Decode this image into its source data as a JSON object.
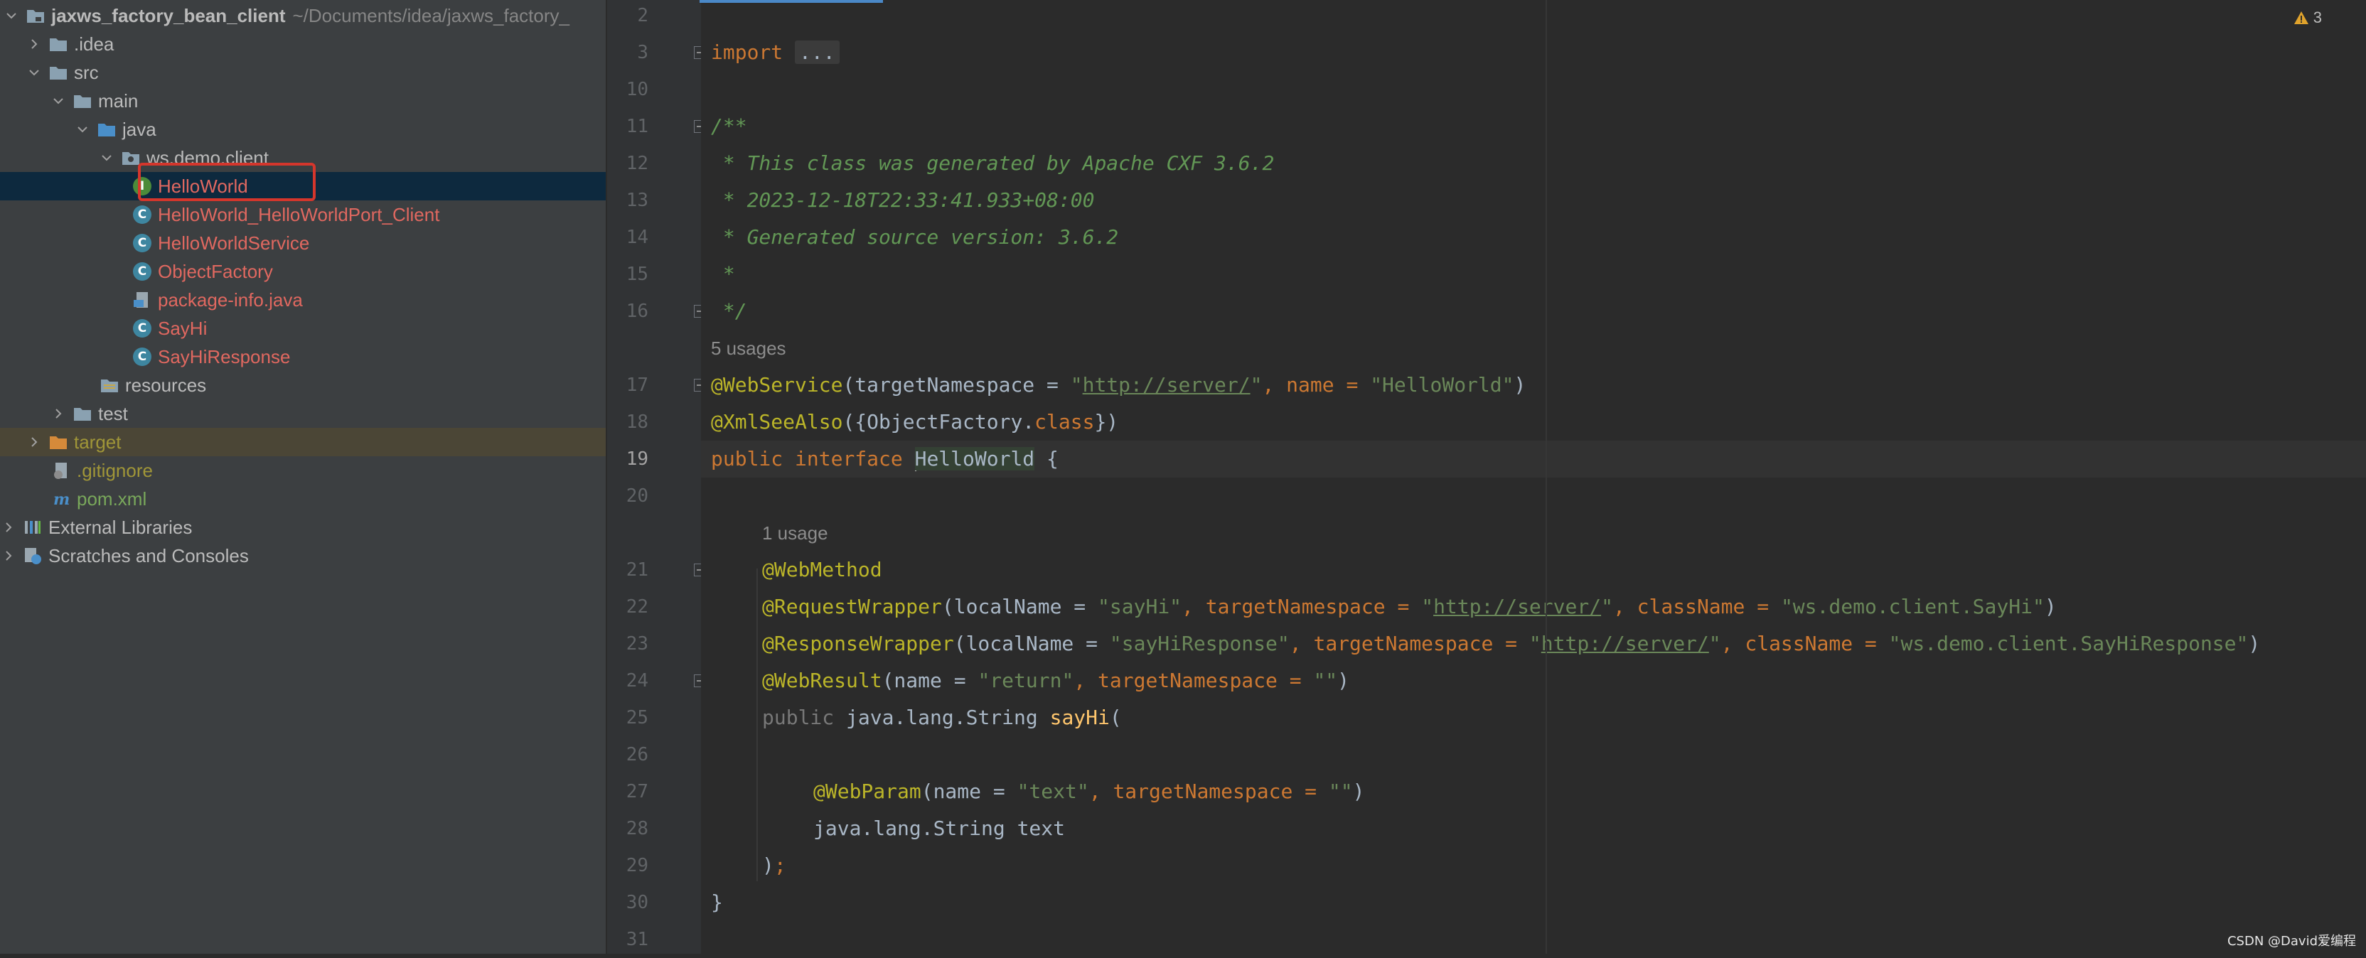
{
  "project_tree": {
    "root": {
      "name": "jaxws_factory_bean_client",
      "path": "~/Documents/idea/jaxws_factory_"
    },
    "items": [
      {
        "label": "jaxws_factory_bean_client"
      },
      {
        "label": ".idea"
      },
      {
        "label": "src"
      },
      {
        "label": "main"
      },
      {
        "label": "java"
      },
      {
        "label": "ws.demo.client"
      },
      {
        "label": "HelloWorld",
        "icon": "I"
      },
      {
        "label": "HelloWorld_HelloWorldPort_Client",
        "icon": "C"
      },
      {
        "label": "HelloWorldService",
        "icon": "C"
      },
      {
        "label": "ObjectFactory",
        "icon": "C"
      },
      {
        "label": "package-info.java"
      },
      {
        "label": "SayHi",
        "icon": "C"
      },
      {
        "label": "SayHiResponse",
        "icon": "C"
      },
      {
        "label": "resources"
      },
      {
        "label": "test"
      },
      {
        "label": "target"
      },
      {
        "label": ".gitignore"
      },
      {
        "label": "pom.xml"
      },
      {
        "label": "External Libraries"
      },
      {
        "label": "Scratches and Consoles"
      }
    ]
  },
  "editor": {
    "warnings_count": "3",
    "line_numbers": [
      "2",
      "3",
      "10",
      "11",
      "12",
      "13",
      "14",
      "15",
      "16",
      "17",
      "18",
      "19",
      "20",
      "21",
      "22",
      "23",
      "24",
      "25",
      "26",
      "27",
      "28",
      "29",
      "30",
      "31"
    ],
    "code": {
      "l3_import": "import",
      "l3_fold": "...",
      "l11": "/**",
      "l12": " * This class was generated by Apache CXF 3.6.2",
      "l13": " * 2023-12-18T22:33:41.933+08:00",
      "l14": " * Generated source version: 3.6.2",
      "l15": " *",
      "l16": " */",
      "usages_5": "5 usages",
      "l17": {
        "ann": "@WebService",
        "p1": "(targetNamespace = ",
        "q1": "\"",
        "url": "http://server/",
        "q2": "\"",
        "p2": ", name = ",
        "s1": "\"HelloWorld\"",
        "p3": ")"
      },
      "l18": {
        "ann": "@XmlSeeAlso",
        "p1": "({ObjectFactory.",
        "kw": "class",
        "p2": "})"
      },
      "l19": {
        "kw1": "public",
        "kw2": "interface",
        "name": "HelloWorld",
        "p1": " {"
      },
      "usages_1": "1 usage",
      "l21": "@WebMethod",
      "l22": {
        "ann": "@RequestWrapper",
        "p1": "(localName = ",
        "s1": "\"sayHi\"",
        "p2": ", targetNamespace = ",
        "q1": "\"",
        "url": "http://server/",
        "q2": "\"",
        "p3": ", className = ",
        "s2": "\"ws.demo.client.SayHi\"",
        "p4": ")"
      },
      "l23": {
        "ann": "@ResponseWrapper",
        "p1": "(localName = ",
        "s1": "\"sayHiResponse\"",
        "p2": ", targetNamespace = ",
        "q1": "\"",
        "url": "http://server/",
        "q2": "\"",
        "p3": ", className = ",
        "s2": "\"ws.demo.client.SayHiResponse\"",
        "p4": ")"
      },
      "l24": {
        "ann": "@WebResult",
        "p1": "(name = ",
        "s1": "\"return\"",
        "p2": ", targetNamespace = ",
        "s2": "\"\"",
        "p3": ")"
      },
      "l25": {
        "kw": "public",
        "p1": " java.lang.String ",
        "fn": "sayHi",
        "p2": "("
      },
      "l27": {
        "ann": "@WebParam",
        "p1": "(name = ",
        "s1": "\"text\"",
        "p2": ", targetNamespace = ",
        "s2": "\"\"",
        "p3": ")"
      },
      "l28": "java.lang.String text",
      "l29": {
        "p1": ")",
        "semi": ";"
      },
      "l30": "}"
    }
  },
  "watermark": "CSDN @David爱编程",
  "colors": {
    "accent": "#4a88c7",
    "selection": "#0d293e",
    "red_box": "#d5362c"
  }
}
